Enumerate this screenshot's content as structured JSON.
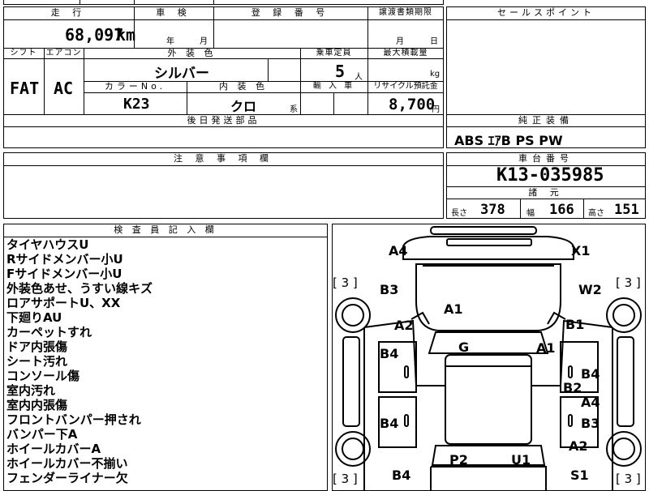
{
  "header": {
    "mileage_label": "走 行",
    "mileage_value": "68,097",
    "mileage_unit": "km",
    "inspection_label": "車 検",
    "inspection_year_unit": "年",
    "inspection_month_unit": "月",
    "registration_label": "登 録 番 号",
    "transfer_label": "譲渡書類期限",
    "transfer_month_unit": "月",
    "transfer_day_unit": "日",
    "sales_point_label": "セールスポイント"
  },
  "row2": {
    "shift_label": "シフト",
    "shift_value": "FAT",
    "aircon_label": "エアコン",
    "aircon_value": "AC",
    "exterior_label": "外 装 色",
    "exterior_value": "シルバー",
    "capacity_label": "乗車定員",
    "capacity_value": "5",
    "capacity_unit": "人",
    "load_label": "最大積載量",
    "load_unit": "kg",
    "color_no_label": "カラーNo.",
    "color_no_value": "K23",
    "interior_label": "内 装 色",
    "interior_value": "クロ",
    "interior_unit": "系",
    "import_label": "輸 入 車",
    "recycle_label": "リサイクル預託金",
    "recycle_value": "8,700",
    "recycle_unit": "円"
  },
  "later_parts_label": "後日発送部品",
  "equipment": {
    "label": "純正装備",
    "value": "ABS  ｴｱB  PS  PW"
  },
  "caution_label": "注 意 事 項 欄",
  "chassis": {
    "label": "車台番号",
    "value": "K13-035985",
    "spec_label": "諸 元",
    "length_label": "長さ",
    "length_value": "378",
    "width_label": "幅",
    "width_value": "166",
    "height_label": "高さ",
    "height_value": "151"
  },
  "inspector": {
    "label": "検 査 員 記 入 欄",
    "notes": [
      "タイヤハウスU",
      "Rサイドメンバー小U",
      "Fサイドメンバー小U",
      "外装色あせ、うすい線キズ",
      "ロアサポートU、XX",
      "下廻りAU",
      "カーペットすれ",
      "ドア内張傷",
      "シート汚れ",
      "コンソール傷",
      "室内汚れ",
      "室内内張傷",
      "フロントバンパー押され",
      "バンパー下A",
      "ホイールカバーA",
      "ホイールカバー不揃い",
      "フェンダーライナー欠"
    ]
  },
  "diagram": {
    "labels": {
      "a4_top": "A4",
      "x1": "X1",
      "bracket_left_top": "[ 3 ]",
      "bracket_right_top": "[ 3 ]",
      "b3_left": "B3",
      "w2": "W2",
      "a1_top": "A1",
      "a2_left": "A2",
      "b1": "B1",
      "b4_left_front": "B4",
      "g": "G",
      "a1_right": "A1",
      "b4_right": "B4",
      "b2": "B2",
      "a4_right": "A4",
      "b4_left_rear": "B4",
      "b3_right": "B3",
      "a2_right": "A2",
      "p2": "P2",
      "u1": "U1",
      "b4_bottom": "B4",
      "s1": "S1",
      "bracket_left_bottom": "[ 3 ]",
      "bracket_right_bottom": "[ 3 ]"
    }
  }
}
